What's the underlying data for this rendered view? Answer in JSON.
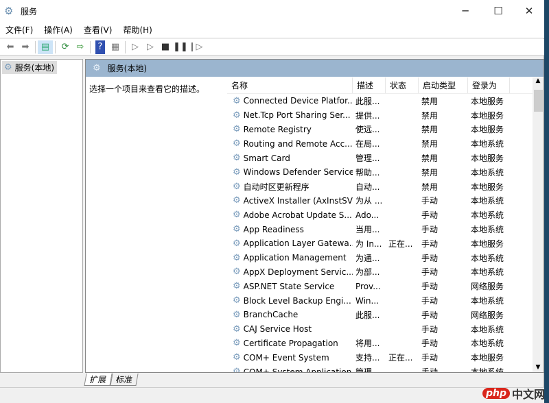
{
  "window": {
    "title": "服务",
    "minimize": "─",
    "maximize": "☐",
    "close": "✕"
  },
  "menu": [
    "文件(F)",
    "操作(A)",
    "查看(V)",
    "帮助(H)"
  ],
  "tree": {
    "root": "服务(本地)"
  },
  "pane": {
    "title": "服务(本地)",
    "description": "选择一个项目来查看它的描述。"
  },
  "columns": [
    "名称",
    "描述",
    "状态",
    "启动类型",
    "登录为"
  ],
  "rows": [
    [
      "Connected Device Platfor...",
      "此服...",
      "",
      "禁用",
      "本地服务"
    ],
    [
      "Net.Tcp Port Sharing Ser...",
      "提供...",
      "",
      "禁用",
      "本地服务"
    ],
    [
      "Remote Registry",
      "使远...",
      "",
      "禁用",
      "本地服务"
    ],
    [
      "Routing and Remote Acc...",
      "在局...",
      "",
      "禁用",
      "本地系统"
    ],
    [
      "Smart Card",
      "管理...",
      "",
      "禁用",
      "本地服务"
    ],
    [
      "Windows Defender Service",
      "帮助...",
      "",
      "禁用",
      "本地系统"
    ],
    [
      "自动时区更新程序",
      "自动...",
      "",
      "禁用",
      "本地服务"
    ],
    [
      "ActiveX Installer (AxInstSV)",
      "为从 ...",
      "",
      "手动",
      "本地系统"
    ],
    [
      "Adobe Acrobat Update S...",
      "Ado...",
      "",
      "手动",
      "本地系统"
    ],
    [
      "App Readiness",
      "当用...",
      "",
      "手动",
      "本地系统"
    ],
    [
      "Application Layer Gatewa...",
      "为 In...",
      "正在...",
      "手动",
      "本地服务"
    ],
    [
      "Application Management",
      "为通...",
      "",
      "手动",
      "本地系统"
    ],
    [
      "AppX Deployment Servic...",
      "为部...",
      "",
      "手动",
      "本地系统"
    ],
    [
      "ASP.NET State Service",
      "Prov...",
      "",
      "手动",
      "网络服务"
    ],
    [
      "Block Level Backup Engi...",
      "Win...",
      "",
      "手动",
      "本地系统"
    ],
    [
      "BranchCache",
      "此服...",
      "",
      "手动",
      "网络服务"
    ],
    [
      "CAJ Service Host",
      "",
      "",
      "手动",
      "本地系统"
    ],
    [
      "Certificate Propagation",
      "将用...",
      "",
      "手动",
      "本地系统"
    ],
    [
      "COM+ Event System",
      "支持...",
      "正在...",
      "手动",
      "本地服务"
    ],
    [
      "COM+ System Application",
      "管理...",
      "",
      "手动",
      "本地系统"
    ]
  ],
  "tabs": [
    "扩展",
    "标准"
  ],
  "watermark": {
    "badge": "php",
    "text": "中文网"
  }
}
